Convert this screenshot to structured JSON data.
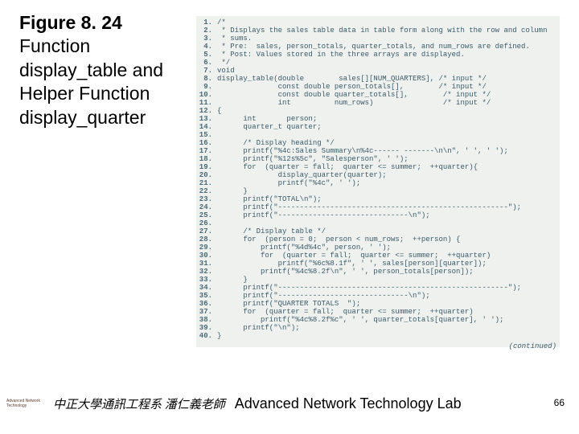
{
  "title": {
    "figure": "Figure 8. 24",
    "rest": "Function display_table and Helper Function display_quarter"
  },
  "code": {
    "lines": [
      "/*",
      " * Displays the sales table data in table form along with the row and column",
      " * sums.",
      " * Pre:  sales, person_totals, quarter_totals, and num_rows are defined.",
      " * Post: Values stored in the three arrays are displayed.",
      " */",
      "void",
      "display_table(double        sales[][NUM_QUARTERS], /* input */",
      "              const double person_totals[],        /* input */",
      "              const double quarter_totals[],        /* input */",
      "              int          num_rows)                /* input */",
      "{",
      "      int       person;",
      "      quarter_t quarter;",
      "",
      "      /* Display heading */",
      "      printf(\"%4c:Sales Summary\\n%4c------ -------\\n\\n\", ' ', ' ');",
      "      printf(\"%12s%5c\", \"Salesperson\", ' ');",
      "      for  (quarter = fall;  quarter <= summer;  ++quarter){",
      "              display_quarter(quarter);",
      "              printf(\"%4c\", ' ');",
      "      }",
      "      printf(\"TOTAL\\n\");",
      "      printf(\"-----------------------------------------------------\");",
      "      printf(\"------------------------------\\n\");",
      "",
      "      /* Display table */",
      "      for  (person = 0;  person < num_rows;  ++person) {",
      "          printf(\"%4d%4c\", person, ' ');",
      "          for  (quarter = fall;  quarter <= summer;  ++quarter)",
      "              printf(\"%6c%8.1f\", ' ', sales[person][quarter]);",
      "          printf(\"%4c%8.2f\\n\", ' ', person_totals[person]);",
      "      }",
      "      printf(\"-----------------------------------------------------\");",
      "      printf(\"------------------------------\\n\");",
      "      printf(\"QUARTER TOTALS  \");",
      "      for  (quarter = fall;  quarter <= summer;  ++quarter)",
      "          printf(\"%4c%8.2f%c\", ' ', quarter_totals[quarter], ' ');",
      "      printf(\"\\n\");",
      "}"
    ]
  },
  "continued": "(continued)",
  "footer": {
    "logo": "Advanced Network Technology",
    "cn": "中正大學通訊工程系 潘仁義老師",
    "en": "Advanced Network Technology Lab"
  },
  "pagenum": "66"
}
